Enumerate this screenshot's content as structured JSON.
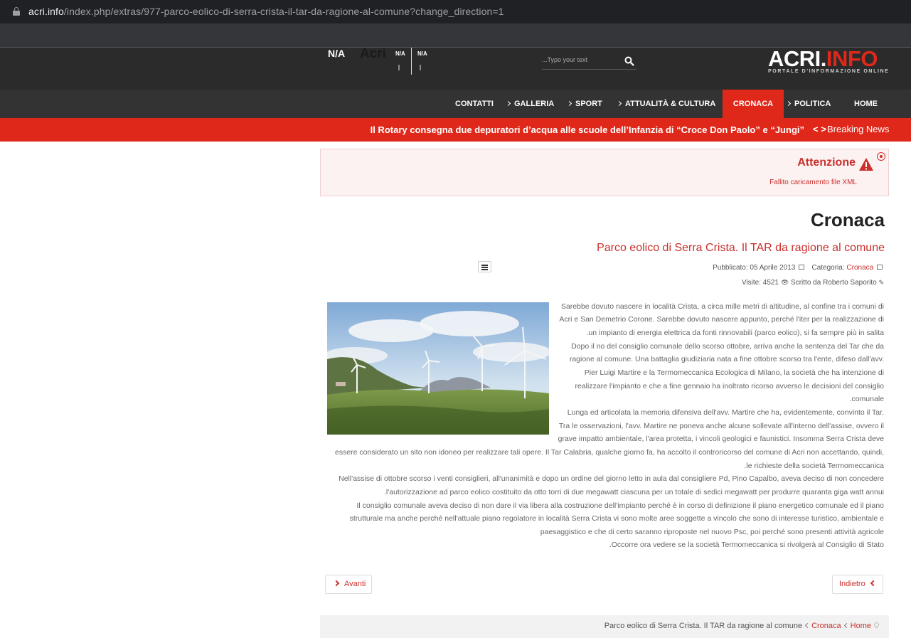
{
  "browser": {
    "url_host": "acri.info",
    "url_path": "/index.php/extras/977-parco-eolico-di-serra-crista-il-tar-da-ragione-al-comune?change_direction=1"
  },
  "header": {
    "na_primary": "N/A",
    "ghost_text": "Acri",
    "na_secondary": [
      "N/A",
      "N/A"
    ],
    "search_placeholder": "...Typo your text",
    "logo_main": "ACRI.",
    "logo_accent": "INFO",
    "logo_tagline": "PORTALE D'INFORMAZIONE ONLINE",
    "brand_color": "#e0281a"
  },
  "nav": {
    "items": [
      {
        "label": "CONTATTI",
        "chevron": false
      },
      {
        "label": "GALLERIA",
        "chevron": true
      },
      {
        "label": "SPORT",
        "chevron": true
      },
      {
        "label": "ATTUALITÀ & CULTURA",
        "chevron": true
      },
      {
        "label": "CRONACA",
        "chevron": false,
        "active": true
      },
      {
        "label": "POLITICA",
        "chevron": true
      },
      {
        "label": "HOME",
        "chevron": false
      }
    ]
  },
  "breaking": {
    "headline": "Il Rotary consegna due depuratori d’acqua alle scuole dell’Infanzia di “Croce Don Paolo” e “Jungi”",
    "arrows": "< >",
    "label": "Breaking News"
  },
  "alert": {
    "title": "Attenzione",
    "message": "Fallito caricamento file XML"
  },
  "article": {
    "category_heading": "Cronaca",
    "title": "Parco eolico di Serra Crista. Il TAR da ragione al comune",
    "published_label": "Pubblicato:",
    "published_date": "05 Aprile 2013",
    "category_label": "Categoria:",
    "category_value": "Cronaca",
    "visits_label": "Visite:",
    "visits_value": "4521",
    "author": "Scritto da Roberto Saporito",
    "lines": [
      "Sarebbe dovuto nascere in località Crista, a circa mille metri di altitudine, al confine tra i comuni di",
      "Acri e San Demetrio Corone. Sarebbe dovuto nascere appunto, perché l'iter per la realizzazione di",
      ".un impianto di energia elettrica da fonti rinnovabili (parco eolico), si fa sempre più in salita",
      "Dopo il no del consiglio comunale dello scorso ottobre, arriva anche la sentenza del Tar che da",
      "ragione al comune. Una battaglia giudiziaria nata a fine ottobre scorso tra l'ente, difeso dall'avv.",
      "Pier Luigi Martire e la Termomeccanica Ecologica di Milano, la società che ha intenzione di",
      "realizzare l'impianto e che a fine gennaio ha inoltrato ricorso avverso le decisioni del consiglio",
      ".comunale",
      "Lunga ed articolata la memoria difensiva dell'avv. Martire che ha, evidentemente, convinto il Tar.",
      "Tra le osservazioni, l'avv. Martire ne poneva anche alcune sollevate all'interno dell'assise, ovvero il",
      "grave impatto ambientale, l'area protetta, i vincoli geologici e faunistici. Insomma Serra Crista deve",
      "essere considerato un sito non idoneo per realizzare tali opere. Il Tar Calabria, qualche giorno fa, ha accolto il controricorso del comune di Acri non accettando, quindi,",
      ".le richieste della società Termomeccanica",
      "Nell'assise di ottobre scorso i venti consiglieri, all'unanimità e dopo un ordine del giorno letto in aula dal consigliere Pd, Pino Capalbo, aveva deciso di non concedere",
      ".l'autorizzazione ad parco eolico costituito da otto torri di due megawatt ciascuna per un totale di sedici megawatt per produrre quaranta giga watt annui",
      "Il consiglio comunale aveva deciso di non dare il via libera alla costruzione dell'impianto perché è in corso di definizione il piano energetico comunale ed il piano",
      "strutturale ma anche perché nell'attuale piano regolatore in località Serra Crista vi sono molte aree soggette a vincolo che sono di interesse turistico, ambientale e",
      "paesaggistico e che di certo saranno riproposte nel nuovo Psc, poi perché sono presenti attività agricole",
      ".Occorre ora vedere se la società Termomeccanica si rivolgerà al Consiglio di Stato"
    ]
  },
  "pager": {
    "next_label": "Avanti",
    "prev_label": "Indietro"
  },
  "breadcrumb": {
    "current": "Parco eolico di Serra Crista. Il TAR da ragione al comune",
    "category": "Cronaca",
    "home": "Home"
  }
}
